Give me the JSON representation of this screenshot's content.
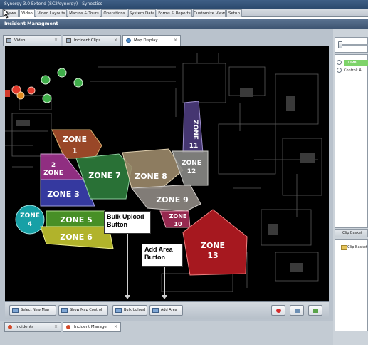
{
  "window": {
    "title": "Synergy 3.0 Extend (SC2/synergy) - Synectics"
  },
  "menu_tabs": [
    {
      "label": "Views"
    },
    {
      "label": "Video"
    },
    {
      "label": "Video Layouts"
    },
    {
      "label": "Macros & Tours"
    },
    {
      "label": "Operations"
    },
    {
      "label": "System Data"
    },
    {
      "label": "Forms & Reports"
    },
    {
      "label": "Customize View"
    },
    {
      "label": "Setup"
    }
  ],
  "incident": {
    "title": "Incident Managment"
  },
  "subtabs": [
    {
      "label": "Video"
    },
    {
      "label": "Incident Clips"
    },
    {
      "label": "Map Display"
    }
  ],
  "zones": [
    {
      "line1": "ZONE",
      "line2": "1"
    },
    {
      "line1": "2",
      "line2": "ZONE"
    },
    {
      "line1": "ZONE 3",
      "line2": ""
    },
    {
      "line1": "ZONE",
      "line2": "4"
    },
    {
      "line1": "ZONE 5",
      "line2": ""
    },
    {
      "line1": "ZONE 6",
      "line2": ""
    },
    {
      "line1": "ZONE 7",
      "line2": ""
    },
    {
      "line1": "ZONE 8",
      "line2": ""
    },
    {
      "line1": "ZONE 9",
      "line2": ""
    },
    {
      "line1": "ZONE",
      "line2": "10"
    },
    {
      "line1": "ZONE",
      "line2": "11"
    },
    {
      "line1": "ZONE",
      "line2": "12"
    },
    {
      "line1": "ZONE",
      "line2": "13"
    }
  ],
  "toolbar": {
    "select_map": "Select New Map",
    "show_map_control": "Show Map Control",
    "bulk_upload": "Bulk Upload",
    "add_area": "Add Area"
  },
  "annotations": {
    "bulk_upload_line1": "Bulk Upload",
    "bulk_upload_line2": "Button",
    "add_area_line1": "Add Area",
    "add_area_line2": "Button"
  },
  "bottom_tabs": [
    {
      "label": "Incidents"
    },
    {
      "label": "Incident Manager"
    }
  ],
  "right_panel": {
    "live_label": "Live",
    "control_label": "Control: Al",
    "clip_header": "Clip Basket",
    "clip_folder": "Clip Basket"
  },
  "colors": {
    "zone1": "#b4532f",
    "zone2": "#a0338f",
    "zone3": "#3b3fb0",
    "zone4": "#17a0a6",
    "zone5": "#4f9f2a",
    "zone6": "#c4c730",
    "zone7": "#2e7d3c",
    "zone8": "#9c8a6a",
    "zone9": "#8f8a84",
    "zone10": "#a62d59",
    "zone11": "#4d3c7d",
    "zone12": "#8a8a86",
    "zone13": "#b81b22"
  }
}
